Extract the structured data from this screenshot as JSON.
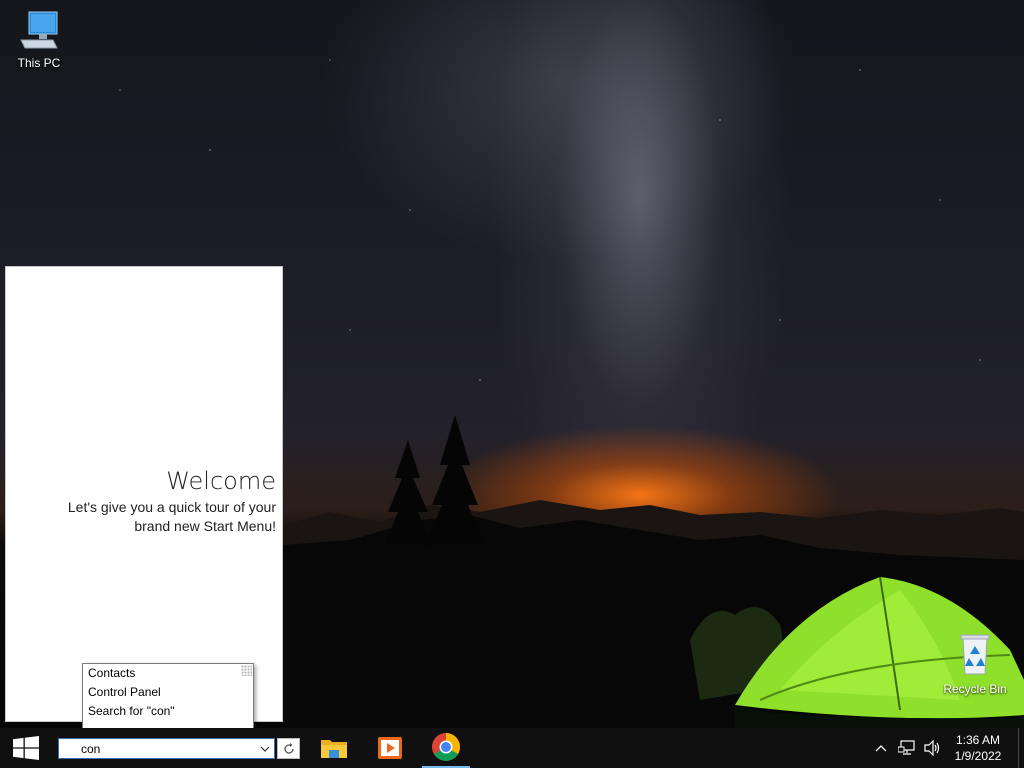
{
  "desktop": {
    "icons": [
      {
        "label": "This PC",
        "icon": "computer-icon"
      },
      {
        "label": "Recycle Bin",
        "icon": "recycle-bin-icon"
      }
    ]
  },
  "start_panel": {
    "title": "Welcome",
    "text": "Let's give you a quick tour of your brand new Start Menu!"
  },
  "suggestions": {
    "items": [
      "Contacts",
      "Control Panel",
      "Search for \"con\""
    ]
  },
  "taskbar": {
    "search_value": "con",
    "apps": [
      {
        "name": "File Explorer",
        "icon": "folder-icon"
      },
      {
        "name": "Media Player",
        "icon": "media-player-icon"
      },
      {
        "name": "Google Chrome",
        "icon": "chrome-icon",
        "active": true
      }
    ],
    "tray": {
      "time": "1:36 AM",
      "date": "1/9/2022"
    }
  },
  "colors": {
    "taskbar": "#101010",
    "accent": "#76b9ed",
    "start_blue": "#ffffff"
  }
}
